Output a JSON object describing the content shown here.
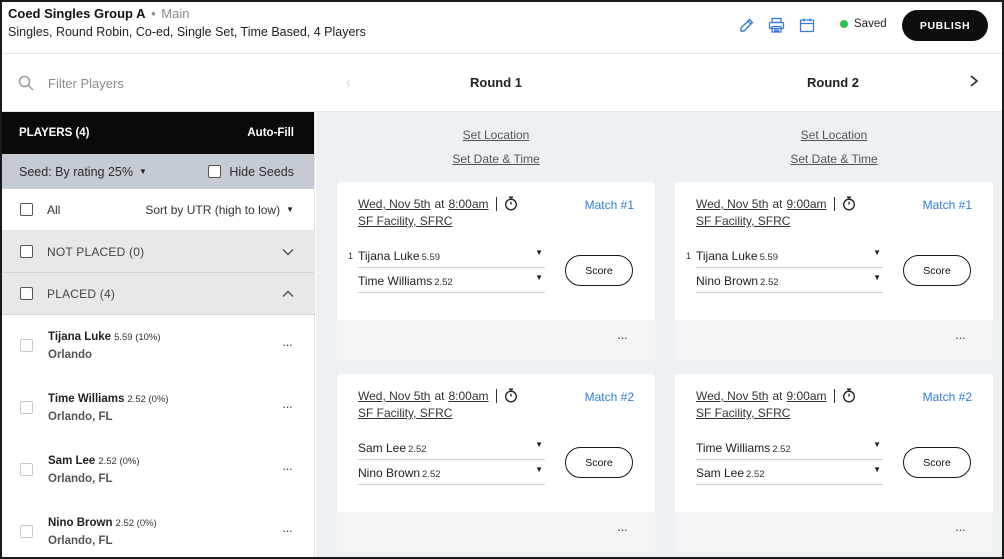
{
  "header": {
    "title": "Coed Singles Group A",
    "separator": "•",
    "subtitle": "Main",
    "description": "Singles, Round Robin, Co-ed, Single Set, Time Based, 4 Players",
    "icons": [
      "pencil-icon",
      "printer-icon",
      "calendar-icon"
    ],
    "status": "Saved",
    "status_color": "#2fbf4f",
    "publish_label": "PUBLISH"
  },
  "filter": {
    "placeholder": "Filter Players"
  },
  "rounds_nav": {
    "prev": "‹",
    "next": "›"
  },
  "sidebar": {
    "players_label": "PLAYERS (4)",
    "autofill_label": "Auto-Fill",
    "seed_label": "Seed: By rating 25%",
    "hide_seeds_label": "Hide Seeds",
    "all_label": "All",
    "sort_label": "Sort by UTR (high to low)",
    "not_placed_label": "NOT PLACED (0)",
    "placed_label": "PLACED (4)",
    "players": [
      {
        "name": "Tijana Luke",
        "rating": "5.59 (10%)",
        "city": "Orlando"
      },
      {
        "name": "Time Williams",
        "rating": "2.52 (0%)",
        "city": "Orlando, FL"
      },
      {
        "name": "Sam Lee",
        "rating": "2.52 (0%)",
        "city": "Orlando, FL"
      },
      {
        "name": "Nino Brown",
        "rating": "2.52 (0%)",
        "city": "Orlando, FL"
      }
    ],
    "more_label": "···"
  },
  "rounds": [
    {
      "title": "Round 1",
      "set_location": "Set Location",
      "set_datetime": "Set Date & Time",
      "matches": [
        {
          "date": "Wed, Nov 5th",
          "at": "at",
          "time": "8:00am",
          "facility": "SF Facility, SFRC",
          "number": "Match #1",
          "p1_seed": "1",
          "p1_name": "Tijana Luke",
          "p1_rating": "5.59",
          "p2_seed": "",
          "p2_name": "Time Williams",
          "p2_rating": "2.52",
          "score_label": "Score",
          "more": "···"
        },
        {
          "date": "Wed, Nov 5th",
          "at": "at",
          "time": "8:00am",
          "facility": "SF Facility, SFRC",
          "number": "Match #2",
          "p1_seed": "",
          "p1_name": "Sam Lee",
          "p1_rating": "2.52",
          "p2_seed": "",
          "p2_name": "Nino Brown",
          "p2_rating": "2.52",
          "score_label": "Score",
          "more": "···"
        }
      ]
    },
    {
      "title": "Round 2",
      "set_location": "Set Location",
      "set_datetime": "Set Date & Time",
      "matches": [
        {
          "date": "Wed, Nov 5th",
          "at": "at",
          "time": "9:00am",
          "facility": "SF Facility, SFRC",
          "number": "Match #1",
          "p1_seed": "1",
          "p1_name": "Tijana Luke",
          "p1_rating": "5.59",
          "p2_seed": "",
          "p2_name": "Nino Brown",
          "p2_rating": "2.52",
          "score_label": "Score",
          "more": "···"
        },
        {
          "date": "Wed, Nov 5th",
          "at": "at",
          "time": "9:00am",
          "facility": "SF Facility, SFRC",
          "number": "Match #2",
          "p1_seed": "",
          "p1_name": "Time Williams",
          "p1_rating": "2.52",
          "p2_seed": "",
          "p2_name": "Sam Lee",
          "p2_rating": "2.52",
          "score_label": "Score",
          "more": "···"
        }
      ]
    }
  ],
  "colors": {
    "accent": "#2f7fd4",
    "icon": "#3a7bd5",
    "publish_bg": "#0e0e0e",
    "seed_bar": "#c5cbd3"
  }
}
